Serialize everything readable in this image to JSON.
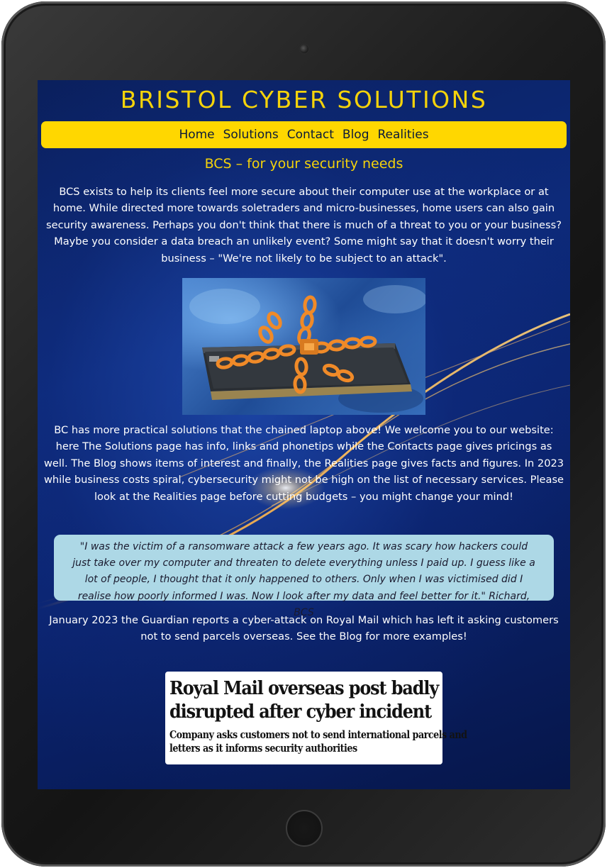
{
  "site": {
    "title": "BRISTOL CYBER SOLUTIONS",
    "subtitle": "BCS – for your security needs"
  },
  "nav": {
    "items": [
      {
        "label": "Home"
      },
      {
        "label": "Solutions"
      },
      {
        "label": "Contact"
      },
      {
        "label": "Blog"
      },
      {
        "label": "Realities"
      }
    ]
  },
  "content": {
    "intro": "BCS exists to help its clients feel more secure about their computer use at the workplace or at home. While directed more towards soletraders and micro-businesses, home users can also gain security awareness. Perhaps you don't think that there is much of a threat to you or your business? Maybe you consider a data breach an unlikely event? Some might say that it doesn't worry their business – \"We're not likely to be subject to an attack\".",
    "solutions_text": "BC has more practical solutions that the chained laptop above! We welcome you to our website: here The Solutions page has info, links and phonetips while the Contacts page gives pricings as well. The Blog shows items of interest and finally, the Realities page gives facts and figures. In 2023 while business costs spiral, cybersecurity might not be high on the list of necessary services. Please look at the Realities page before cutting budgets – you might change your mind!",
    "testimonial": "\"I was the victim of a ransomware attack a few years ago. It was scary how hackers could just take over my computer and threaten to delete everything unless I paid up. I guess like a lot of people, I thought that it only happened to others. Only when I was victimised did I realise how poorly informed I was. Now I look after my data and feel better for it.\" Richard, BCS",
    "news_text": "January 2023 the Guardian reports a cyber-attack on Royal Mail which has left it asking customers not to send parcels overseas. See the Blog for more examples!"
  },
  "headline_image": {
    "headline_line1": "Royal Mail overseas post badly",
    "headline_line2": "disrupted after cyber incident",
    "subheadline_line1": "Company asks customers not to send international parcels and",
    "subheadline_line2": "letters as it informs security authorities"
  },
  "colors": {
    "accent_yellow": "#ffd700",
    "title_yellow": "#f5d30a",
    "background_blue": "#0d2a7a",
    "testimonial_bg": "#add8e6",
    "device_frame": "#1c1c1c"
  },
  "icons": {
    "camera": "camera-dot-icon",
    "home_button": "home-button-icon"
  }
}
